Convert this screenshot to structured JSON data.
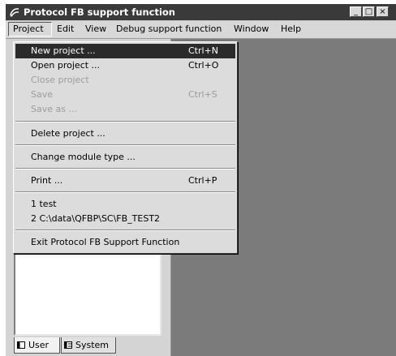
{
  "window": {
    "title": "Protocol FB support function",
    "controls": {
      "minimize": "_",
      "maximize": "□",
      "close": "×"
    }
  },
  "menubar": {
    "items": [
      "Project",
      "Edit",
      "View",
      "Debug support function",
      "Window",
      "Help"
    ]
  },
  "project_menu": {
    "items": [
      {
        "label": "New project ...",
        "shortcut": "Ctrl+N",
        "state": "highlighted"
      },
      {
        "label": "Open project ...",
        "shortcut": "Ctrl+O",
        "state": "enabled"
      },
      {
        "label": "Close project",
        "shortcut": "",
        "state": "disabled"
      },
      {
        "label": "Save",
        "shortcut": "Ctrl+S",
        "state": "disabled"
      },
      {
        "label": "Save as ...",
        "shortcut": "",
        "state": "disabled"
      },
      {
        "label": "Delete project ...",
        "shortcut": "",
        "state": "enabled"
      },
      {
        "label": "Change module type ...",
        "shortcut": "",
        "state": "enabled"
      },
      {
        "label": "Print ...",
        "shortcut": "Ctrl+P",
        "state": "enabled"
      },
      {
        "label": "1 test",
        "shortcut": "",
        "state": "enabled"
      },
      {
        "label": "2 C:\\data\\QFBP\\SC\\FB_TEST2",
        "shortcut": "",
        "state": "enabled"
      },
      {
        "label": "Exit Protocol FB Support Function",
        "shortcut": "",
        "state": "enabled"
      }
    ]
  },
  "tabs": [
    {
      "label": "User",
      "icon": "page-icon",
      "active": true
    },
    {
      "label": "System",
      "icon": "page-icon",
      "active": false
    }
  ],
  "colors": {
    "title_bar": "#3a3a3a",
    "highlight": "#2b2b2b",
    "workspace": "#7b7b7b"
  }
}
